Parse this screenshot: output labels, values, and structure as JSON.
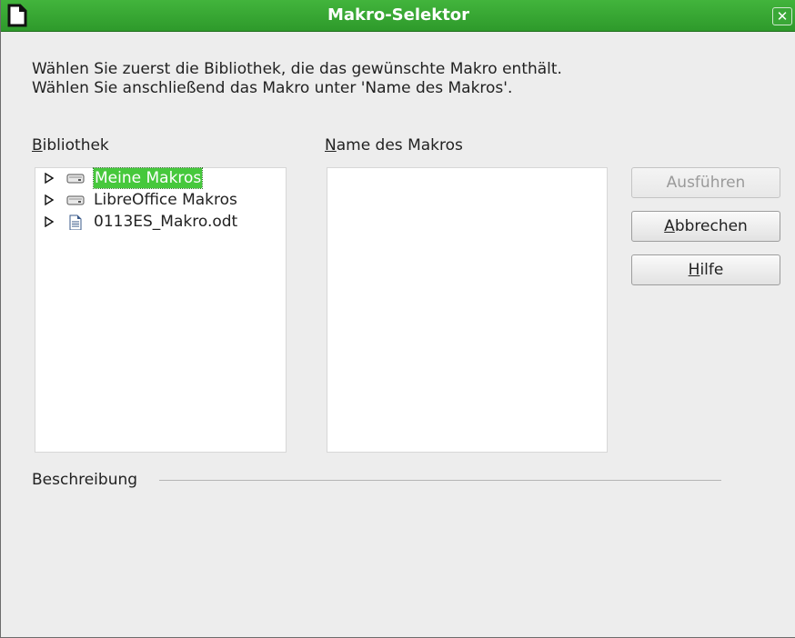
{
  "window": {
    "title": "Makro-Selektor",
    "close_label": "✕"
  },
  "intro": {
    "text": "Wählen Sie zuerst die Bibliothek, die das gewünschte Makro enthält. Wählen Sie anschließend das Makro unter 'Name des Makros'."
  },
  "library": {
    "label_mnemonic": "B",
    "label_rest": "ibliothek",
    "items": [
      {
        "label": "Meine Makros",
        "icon": "drive-icon",
        "selected": true
      },
      {
        "label": "LibreOffice Makros",
        "icon": "drive-icon",
        "selected": false
      },
      {
        "label": "0113ES_Makro.odt",
        "icon": "document-icon",
        "selected": false
      }
    ]
  },
  "macro_names": {
    "label_mnemonic": "N",
    "label_rest": "ame des Makros"
  },
  "buttons": {
    "run_label": "Ausführen",
    "cancel_mnemonic": "A",
    "cancel_rest": "bbrechen",
    "help_mnemonic": "H",
    "help_rest": "ilfe"
  },
  "description": {
    "label": "Beschreibung"
  },
  "colors": {
    "titlebar": "#3aa837",
    "selection": "#46c83c"
  }
}
